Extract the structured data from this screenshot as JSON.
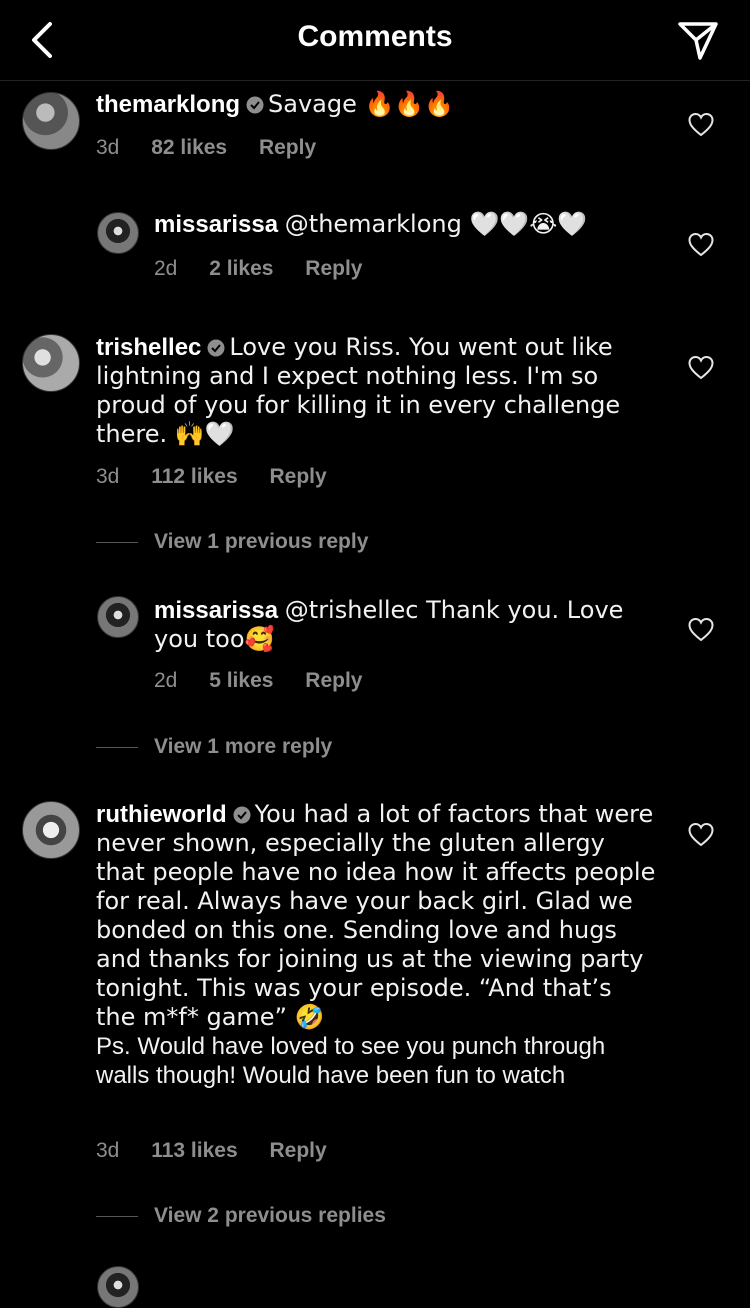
{
  "header": {
    "title": "Comments"
  },
  "comments": [
    {
      "username": "themarklong",
      "text": "Savage 🔥🔥🔥",
      "age": "3d",
      "likes": "82 likes",
      "reply": "Reply"
    },
    {
      "username": "missarissa",
      "text": "@themarklong 🤍🤍😭🤍",
      "age": "2d",
      "likes": "2 likes",
      "reply": "Reply"
    },
    {
      "username": "trishellec",
      "text": "Love you Riss. You went out like lightning and I expect nothing less. I'm so proud of you for killing it in every challenge there. 🙌🤍",
      "age": "3d",
      "likes": "112 likes",
      "reply": "Reply"
    },
    {
      "username": "missarissa",
      "text": "@trishellec Thank you.  Love you too🥰",
      "age": "2d",
      "likes": "5 likes",
      "reply": "Reply"
    },
    {
      "username": "ruthieworld",
      "text": "You had a lot of factors that were never shown, especially the gluten allergy that people have no idea how it affects people for real. Always have your back girl. Glad we bonded on this one. Sending love and hugs and thanks for joining us at the viewing party tonight. This was your episode. “And that’s the m*f* game” 🤣",
      "text2": "Ps. Would have loved to see you punch through walls though! Would have been fun to watch",
      "age": "3d",
      "likes": "113 likes",
      "reply": "Reply"
    }
  ],
  "view_replies": [
    "View 1 previous reply",
    "View 1 more reply",
    "View 2 previous replies"
  ]
}
